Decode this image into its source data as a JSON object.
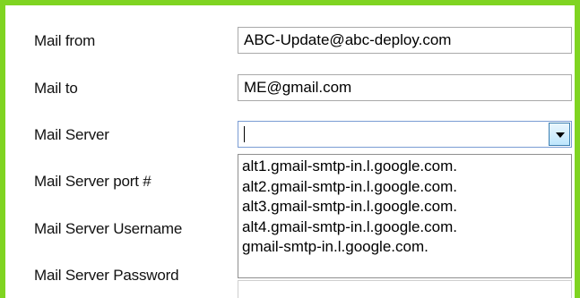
{
  "form": {
    "mail_from": {
      "label": "Mail from",
      "value": "ABC-Update@abc-deploy.com"
    },
    "mail_to": {
      "label": "Mail to",
      "value": "ME@gmail.com"
    },
    "mail_server": {
      "label": "Mail Server",
      "value": "",
      "options": [
        "alt1.gmail-smtp-in.l.google.com.",
        "alt2.gmail-smtp-in.l.google.com.",
        "alt3.gmail-smtp-in.l.google.com.",
        "alt4.gmail-smtp-in.l.google.com.",
        "gmail-smtp-in.l.google.com."
      ]
    },
    "mail_server_port": {
      "label": "Mail Server port #"
    },
    "mail_server_username": {
      "label": "Mail Server Username"
    },
    "mail_server_password": {
      "label": "Mail Server Password"
    }
  },
  "colors": {
    "frame_border": "#7fd421",
    "combo_focus_border": "#7a9cd3"
  },
  "icons": {
    "dropdown_button": "chevron-down-icon"
  }
}
